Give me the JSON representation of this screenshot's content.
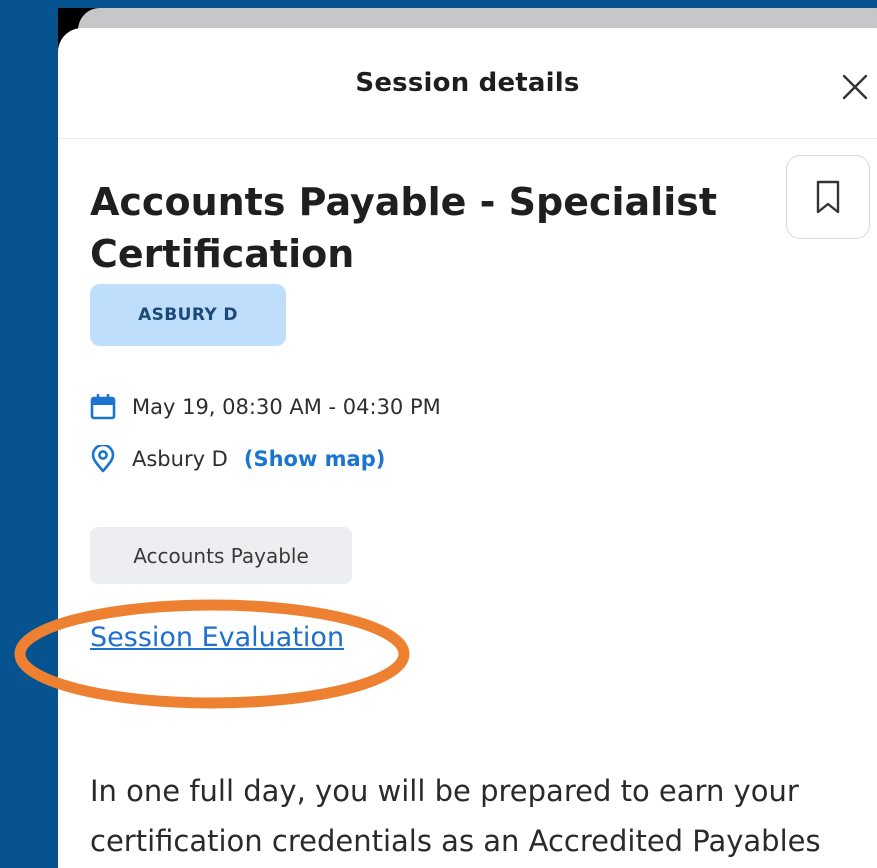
{
  "header": {
    "title": "Session details"
  },
  "session": {
    "title": "Accounts Payable - Specialist Certification",
    "room_badge": "ASBURY D",
    "datetime": "May 19, 08:30 AM - 04:30 PM",
    "location": "Asbury D",
    "show_map_label": "(Show map)",
    "track_tag": "Accounts Payable",
    "evaluation_link": "Session Evaluation",
    "description": "In one full day, you will be prepared to earn your certification credentials as an Accredited Payables"
  },
  "icons": {
    "close": "close-icon",
    "bookmark": "bookmark-icon",
    "calendar": "calendar-icon",
    "location": "location-pin-icon"
  },
  "colors": {
    "background": "#07538f",
    "accent_blue": "#1a74d0",
    "badge_bg": "#bfdefc",
    "annotation_orange": "#ee8131"
  }
}
